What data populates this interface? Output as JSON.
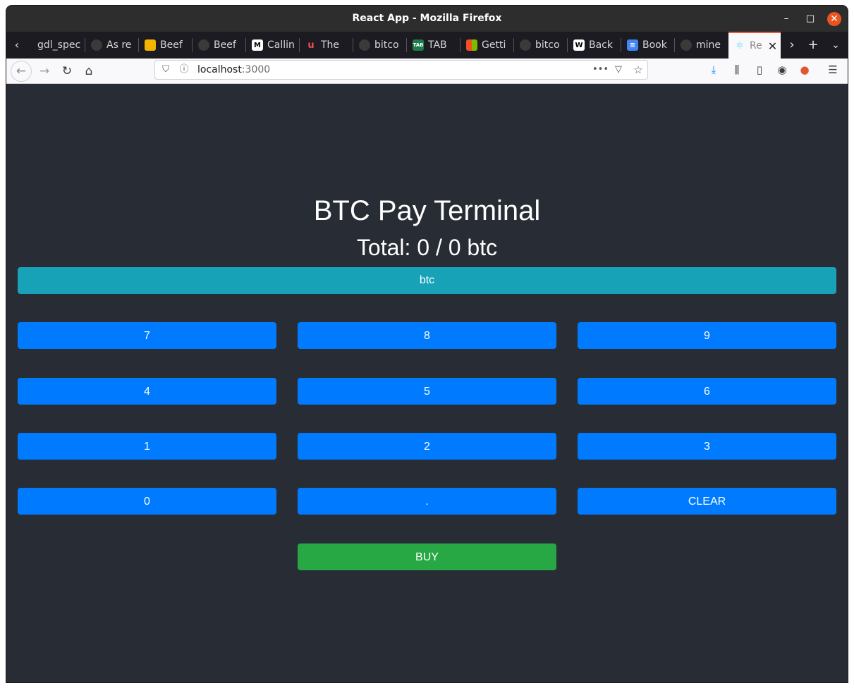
{
  "window": {
    "title": "React App - Mozilla Firefox",
    "minimize_glyph": "–",
    "maximize_glyph": "□",
    "close_glyph": "✕"
  },
  "tabs": [
    {
      "label": "gdl_spec",
      "icon": "none"
    },
    {
      "label": "As re",
      "icon": "github-icon"
    },
    {
      "label": "Beef",
      "icon": "slides-icon"
    },
    {
      "label": "Beef",
      "icon": "github-icon"
    },
    {
      "label": "Callin",
      "icon": "medium-icon"
    },
    {
      "label": "The",
      "icon": "udemy-icon"
    },
    {
      "label": "bitco",
      "icon": "github-icon"
    },
    {
      "label": "TAB",
      "icon": "tab-icon"
    },
    {
      "label": "Getti",
      "icon": "microsoft-icon"
    },
    {
      "label": "bitco",
      "icon": "github-icon"
    },
    {
      "label": "Back",
      "icon": "wikipedia-icon"
    },
    {
      "label": "Book",
      "icon": "docs-icon"
    },
    {
      "label": "mine",
      "icon": "github-icon"
    },
    {
      "label": "Re",
      "icon": "react-icon",
      "active": true
    }
  ],
  "navbar": {
    "url_host": "localhost",
    "url_port": ":3000"
  },
  "app": {
    "heading": "BTC Pay Terminal",
    "total_text": "Total: 0 / 0 btc",
    "currency_button": "btc",
    "keys": [
      [
        "7",
        "8",
        "9"
      ],
      [
        "4",
        "5",
        "6"
      ],
      [
        "1",
        "2",
        "3"
      ],
      [
        "0",
        ".",
        "CLEAR"
      ]
    ],
    "buy_button": "BUY"
  },
  "colors": {
    "background": "#282c34",
    "currency_button": "#17a2b8",
    "key_button": "#007bff",
    "buy_button": "#28a745",
    "close_button": "#e95420",
    "active_tab_accent": "#e55b3c"
  }
}
